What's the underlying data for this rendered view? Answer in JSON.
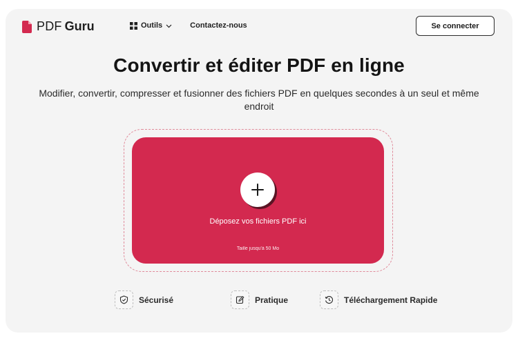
{
  "brand": {
    "pdf": "PDF",
    "guru": "Guru",
    "accent": "#d3294f"
  },
  "nav": {
    "tools_label": "Outils",
    "contact_label": "Contactez-nous"
  },
  "header": {
    "login_label": "Se connecter"
  },
  "hero": {
    "title": "Convertir et éditer PDF en ligne",
    "subtitle": "Modifier, convertir, compresser et fusionner des fichiers PDF en quelques secondes à un seul et même endroit"
  },
  "dropzone": {
    "label": "Déposez vos fichiers PDF ici",
    "size_note": "Taille jusqu'à 50 Mo",
    "icon": "plus-icon"
  },
  "features": [
    {
      "label": "Sécurisé",
      "icon": "shield-check-icon"
    },
    {
      "label": "Pratique",
      "icon": "edit-icon"
    },
    {
      "label": "Téléchargement Rapide",
      "icon": "clock-history-icon"
    }
  ]
}
